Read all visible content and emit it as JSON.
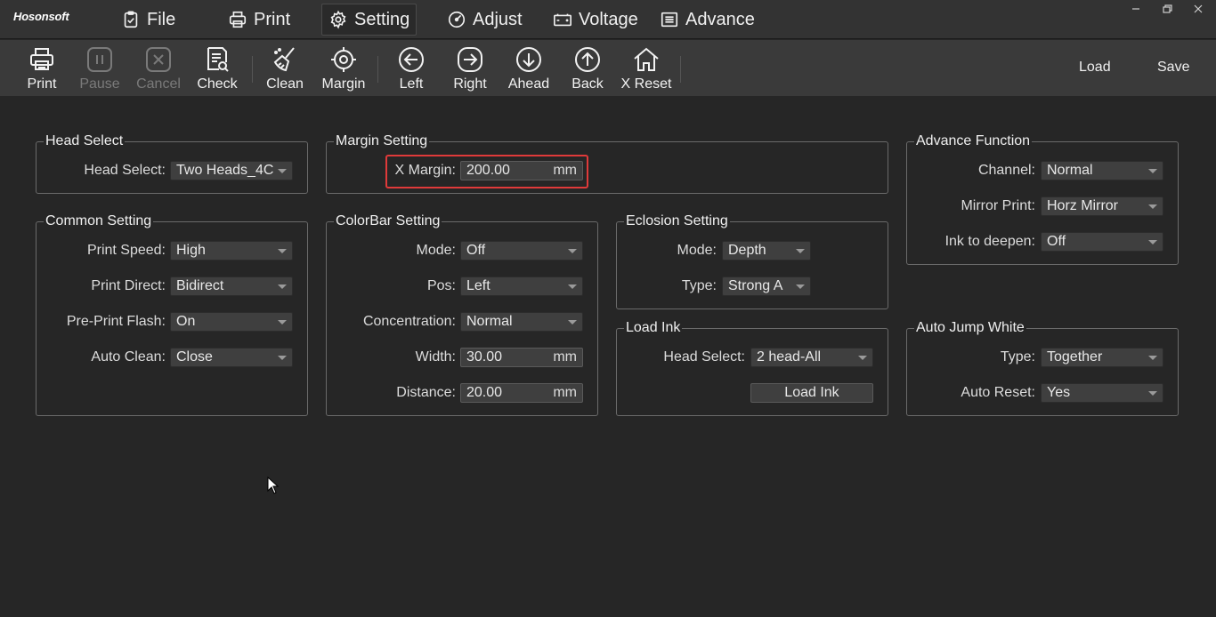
{
  "app": {
    "logo": "Hosonsoft"
  },
  "menu": {
    "file": "File",
    "print": "Print",
    "setting": "Setting",
    "adjust": "Adjust",
    "voltage": "Voltage",
    "advance": "Advance"
  },
  "toolbar": {
    "print": "Print",
    "pause": "Pause",
    "cancel": "Cancel",
    "check": "Check",
    "clean": "Clean",
    "margin": "Margin",
    "left": "Left",
    "right": "Right",
    "ahead": "Ahead",
    "back": "Back",
    "x_reset": "X Reset",
    "load": "Load",
    "save": "Save"
  },
  "head_select": {
    "title": "Head Select",
    "label": "Head Select:",
    "value": "Two Heads_4C"
  },
  "margin_setting": {
    "title": "Margin Setting",
    "x_margin_label": "X Margin:",
    "x_margin_value": "200.00",
    "unit": "mm"
  },
  "advance_function": {
    "title": "Advance Function",
    "channel_label": "Channel:",
    "channel_value": "Normal",
    "mirror_label": "Mirror Print:",
    "mirror_value": "Horz Mirror",
    "ink_label": "Ink to deepen:",
    "ink_value": "Off"
  },
  "common_setting": {
    "title": "Common Setting",
    "speed_label": "Print Speed:",
    "speed_value": "High",
    "direct_label": "Print Direct:",
    "direct_value": "Bidirect",
    "flash_label": "Pre-Print Flash:",
    "flash_value": "On",
    "clean_label": "Auto Clean:",
    "clean_value": "Close"
  },
  "colorbar_setting": {
    "title": "ColorBar Setting",
    "mode_label": "Mode:",
    "mode_value": "Off",
    "pos_label": "Pos:",
    "pos_value": "Left",
    "conc_label": "Concentration:",
    "conc_value": "Normal",
    "width_label": "Width:",
    "width_value": "30.00",
    "distance_label": "Distance:",
    "distance_value": "20.00",
    "unit": "mm"
  },
  "eclosion_setting": {
    "title": "Eclosion Setting",
    "mode_label": "Mode:",
    "mode_value": "Depth",
    "type_label": "Type:",
    "type_value": "Strong A"
  },
  "load_ink": {
    "title": "Load Ink",
    "head_label": "Head Select:",
    "head_value": "2 head-All",
    "button": "Load Ink"
  },
  "auto_jump_white": {
    "title": "Auto Jump White",
    "type_label": "Type:",
    "type_value": "Together",
    "reset_label": "Auto Reset:",
    "reset_value": "Yes"
  },
  "colors": {
    "background": "#262626",
    "menubar": "#333333",
    "toolbar": "#3a3a3a",
    "highlight": "#e03a3a"
  }
}
